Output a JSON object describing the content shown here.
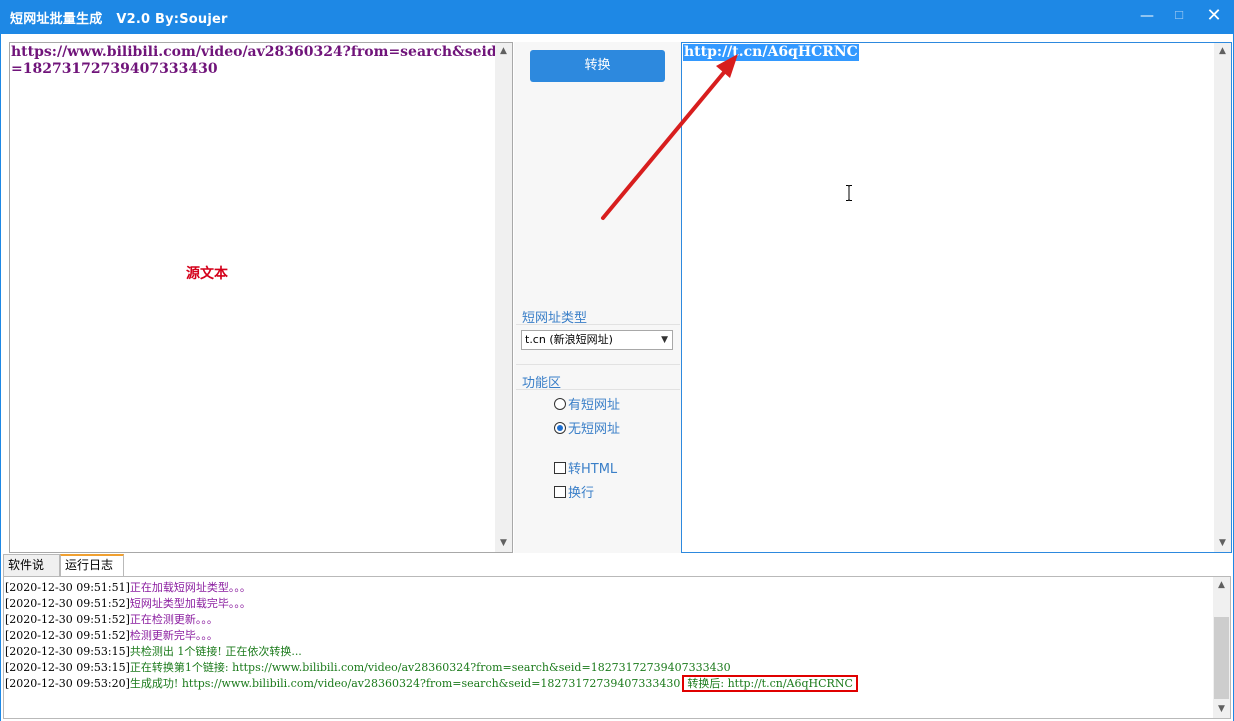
{
  "window": {
    "title": "短网址批量生成",
    "version": "V2.0 By:Soujer",
    "min_label": "—",
    "max_label": "☐",
    "close_label": "✕"
  },
  "source": {
    "text": "https://www.bilibili.com/video/av28360324?from=search&seid=18273172739407333430",
    "watermark": "源文本"
  },
  "middle": {
    "convert_label": "转换",
    "type_group_label": "短网址类型",
    "type_selected": "t.cn (新浪短网址)",
    "func_group_label": "功能区",
    "radio_has": "有短网址",
    "radio_none": "无短网址",
    "check_html": "转HTML",
    "check_wrap": "换行"
  },
  "output": {
    "text": "http://t.cn/A6qHCRNC"
  },
  "tabs": [
    {
      "label": "软件说明"
    },
    {
      "label": "运行日志"
    }
  ],
  "log": [
    {
      "ts": "[2020-12-30 09:51:51]",
      "msg": "正在加载短网址类型。。。",
      "extra": ""
    },
    {
      "ts": "[2020-12-30 09:51:52]",
      "msg": "短网址类型加载完毕。。。",
      "extra": ""
    },
    {
      "ts": "[2020-12-30 09:51:52]",
      "msg": "正在检测更新。。。",
      "extra": ""
    },
    {
      "ts": "[2020-12-30 09:51:52]",
      "msg": "检测更新完毕。。。",
      "extra": ""
    },
    {
      "ts": "[2020-12-30 09:53:15]",
      "msg": "共检测出 1个链接! 正在依次转换...",
      "extra": ""
    },
    {
      "ts": "[2020-12-30 09:53:15]",
      "msg": "正在转换第1个链接: https://www.bilibili.com/video/av28360324?from=search&seid=18273172739407333430",
      "extra": ""
    },
    {
      "ts": "[2020-12-30 09:53:20]",
      "msg": "生成成功! https://www.bilibili.com/video/av28360324?from=search&seid=18273172739407333430",
      "extra": "转换后: http://t.cn/A6qHCRNC"
    }
  ],
  "colors": {
    "titlebar": "#1e88e5",
    "accent_button": "#2d89de",
    "annotation_red": "#e00000"
  }
}
